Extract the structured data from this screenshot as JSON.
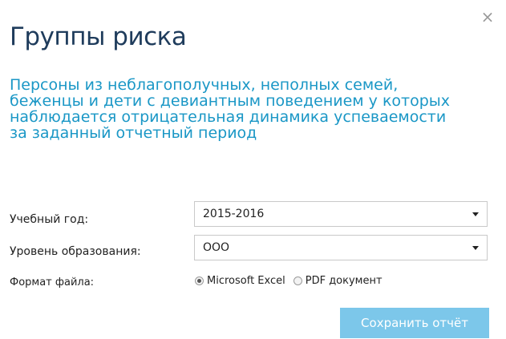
{
  "dialog": {
    "close_glyph": "×",
    "title": "Группы риска",
    "subtitle": "Персоны из неблагополучных, неполных семей, беженцы и дети с девиантным поведением у которых наблюдается отрицательная динамика успеваемости за заданный отчетный период"
  },
  "form": {
    "year": {
      "label": "Учебный год:",
      "value": "2015-2016"
    },
    "level": {
      "label": "Уровень образования:",
      "value": "ООО"
    },
    "format": {
      "label": "Формат файла:",
      "options": [
        {
          "label": "Microsoft Excel",
          "checked": true
        },
        {
          "label": "PDF документ",
          "checked": false
        }
      ]
    },
    "save_label": "Сохранить отчёт"
  },
  "colors": {
    "title": "#1f3c5c",
    "subtitle": "#1a97c6",
    "button": "#7cc7ea"
  },
  "icons": {
    "close": "close-icon",
    "dropdown": "chevron-down-icon"
  }
}
